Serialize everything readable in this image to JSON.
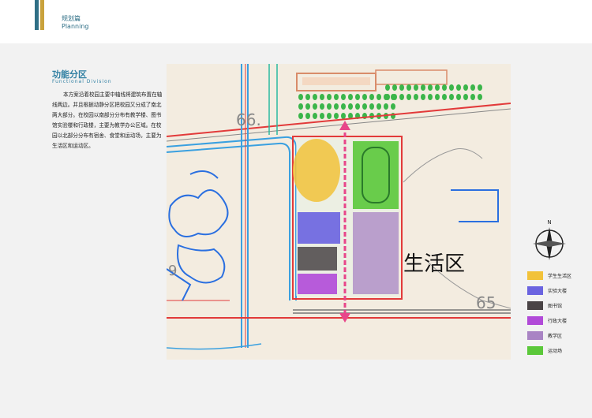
{
  "header": {
    "title_cn": "规划篇",
    "title_en": "Planning"
  },
  "section": {
    "title": "功能分区",
    "subtitle": "Functional Division",
    "body": "本方案沿着校园主要中轴线将建筑布置在轴线两边。并且根据动静分区把校园又分成了南北两大部分。在校园以南部分分布有教学楼、图书馆实验楼和行政楼，主要为教学办公区域。在校园以北部分分布有宿舍、食堂和运动场，主要为生活区和运动区。"
  },
  "map": {
    "zone_label": "生活区",
    "contours": [
      "66.",
      "65",
      "9"
    ]
  },
  "compass": {
    "north": "N"
  },
  "legend": [
    {
      "label": "学生生活区",
      "color": "#f2c23a"
    },
    {
      "label": "实验大楼",
      "color": "#6a63e0"
    },
    {
      "label": "图书馆",
      "color": "#4a4446"
    },
    {
      "label": "行政大楼",
      "color": "#b14ad8"
    },
    {
      "label": "教学区",
      "color": "#a984c4"
    },
    {
      "label": "运动场",
      "color": "#5bc83a"
    }
  ]
}
